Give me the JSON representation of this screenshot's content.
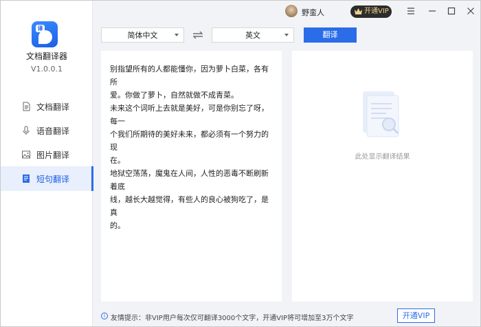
{
  "app": {
    "name": "文档翻译器",
    "version": "V1.0.0.1"
  },
  "sidebar": {
    "items": [
      {
        "label": "文档翻译",
        "icon": "document-icon",
        "active": false
      },
      {
        "label": "语音翻译",
        "icon": "microphone-icon",
        "active": false
      },
      {
        "label": "图片翻译",
        "icon": "image-icon",
        "active": false
      },
      {
        "label": "短句翻译",
        "icon": "text-document-icon",
        "active": true
      }
    ]
  },
  "topbar": {
    "username": "野蛮人",
    "vip_label": "开通VIP"
  },
  "language": {
    "source": "简体中文",
    "target": "英文",
    "translate_label": "翻译"
  },
  "source_panel": {
    "text": "别指望所有的人都能懂你，因为萝卜白菜，各有所\n爱。你做了萝卜，自然就做不成青菜。\n未来这个词听上去就是美好，可是你别忘了呀，每一\n个我们所期待的美好未来，都必须有一个努力的现\n在。\n地狱空荡荡，魔鬼在人间，人性的恶毒不断刷新着底\n线，越长大越觉得，有些人的良心被狗吃了，是真\n的。"
  },
  "result_panel": {
    "placeholder": "此处显示翻译结果"
  },
  "footer": {
    "tip_icon": "info-icon",
    "tip": "友情提示：非VIP用户每次仅可翻译3000个文字，开通VIP将可增加至3万个文字",
    "vip_label": "开通VIP"
  },
  "colors": {
    "accent": "#2b6de8",
    "vip_bg": "#2c2c2c",
    "vip_text": "#f0d08a",
    "app_bg": "#f2f3f7"
  }
}
